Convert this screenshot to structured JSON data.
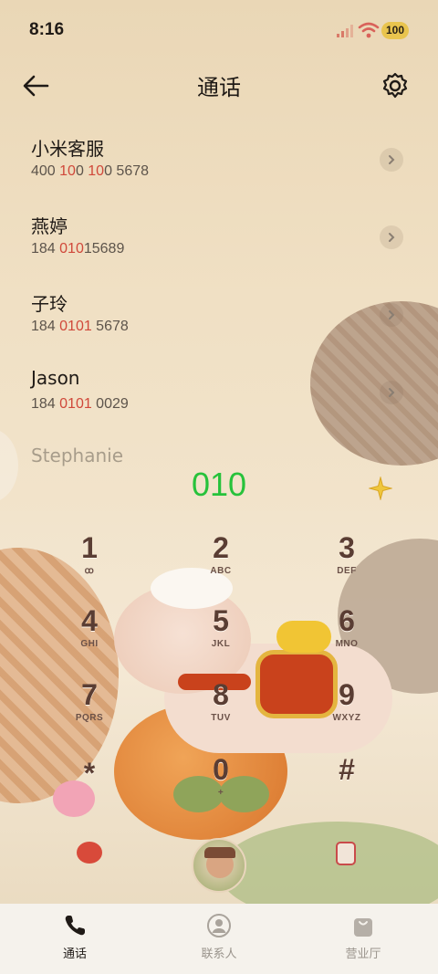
{
  "status_bar": {
    "time": "8:16",
    "battery": "100"
  },
  "header": {
    "title": "通话"
  },
  "contacts": [
    {
      "name": "小米客服",
      "num_parts": [
        "400 ",
        "10",
        "0 ",
        "10",
        "0 5678"
      ]
    },
    {
      "name": "燕婷",
      "num_parts": [
        "184 ",
        "010",
        "15689",
        "",
        ""
      ]
    },
    {
      "name": "子玲",
      "num_parts": [
        "184 ",
        "0101",
        " 5678",
        "",
        ""
      ]
    },
    {
      "name": "Jason",
      "num_parts": [
        "184 ",
        "0101",
        " 0029",
        "",
        ""
      ]
    },
    {
      "name": "Stephanie",
      "num_parts": [
        "",
        "",
        "",
        "",
        ""
      ]
    }
  ],
  "dialer": {
    "display": "010",
    "keys": [
      {
        "digit": "1",
        "letters": "ꝏ"
      },
      {
        "digit": "2",
        "letters": "ABC"
      },
      {
        "digit": "3",
        "letters": "DEF"
      },
      {
        "digit": "4",
        "letters": "GHI"
      },
      {
        "digit": "5",
        "letters": "JKL"
      },
      {
        "digit": "6",
        "letters": "MNO"
      },
      {
        "digit": "7",
        "letters": "PQRS"
      },
      {
        "digit": "8",
        "letters": "TUV"
      },
      {
        "digit": "9",
        "letters": "WXYZ"
      },
      {
        "digit": "*",
        "letters": ""
      },
      {
        "digit": "0",
        "letters": "+"
      },
      {
        "digit": "#",
        "letters": ""
      }
    ]
  },
  "tabs": [
    {
      "label": "通话",
      "icon": "phone-icon",
      "active": true
    },
    {
      "label": "联系人",
      "icon": "person-icon",
      "active": false
    },
    {
      "label": "营业厅",
      "icon": "shopping-bag-icon",
      "active": false
    }
  ],
  "colors": {
    "accent_green": "#27c23b",
    "highlight_red": "#d0483a",
    "key_brown": "#5a3d33"
  }
}
